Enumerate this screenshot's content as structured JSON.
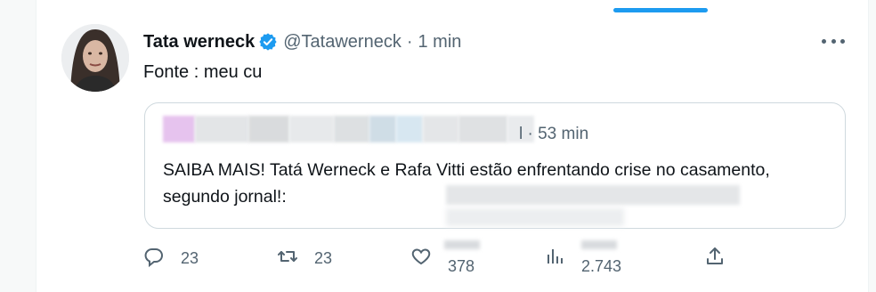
{
  "tweet": {
    "author_name": "Tata werneck",
    "handle": "@Tatawerneck",
    "separator": "·",
    "time": "1 min",
    "text": "Fonte : meu cu"
  },
  "quoted_tweet": {
    "meta": "l · 53 min",
    "text": "SAIBA MAIS! Tatá Werneck e Rafa Vitti estão enfrentando crise no casamento, segundo jornal!:"
  },
  "actions": {
    "replies": "23",
    "retweets": "23",
    "likes": "378",
    "views": "2.743"
  },
  "icons": {
    "verified": "verified-badge-icon",
    "more": "more-options-icon",
    "reply": "reply-icon",
    "retweet": "retweet-icon",
    "like": "heart-icon",
    "views": "views-icon",
    "share": "share-icon"
  },
  "colors": {
    "accent": "#1d9bf0",
    "text": "#0f1419",
    "muted": "#536471",
    "border": "#cfd9de"
  }
}
